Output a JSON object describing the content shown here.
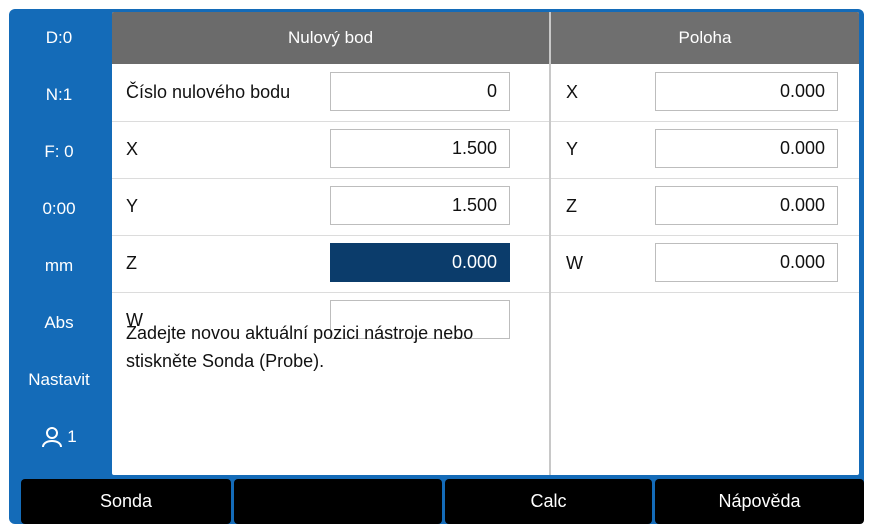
{
  "status_bar": {
    "datum": "D:0",
    "tool": "N:1",
    "feed": "F:  0",
    "time": "0:00",
    "units": "mm",
    "mode": "Abs",
    "setup": "Nastavit",
    "user": "1"
  },
  "datum_panel": {
    "title": "Nulový bod",
    "rows": [
      {
        "label": "Číslo nulového bodu",
        "value": "0",
        "active": false
      },
      {
        "label": "X",
        "value": "1.500",
        "active": false
      },
      {
        "label": "Y",
        "value": "1.500",
        "active": false
      },
      {
        "label": "Z",
        "value": "0.000",
        "active": true
      },
      {
        "label": "W",
        "value": "",
        "active": false
      }
    ],
    "message": "Zadejte novou aktuální pozici nástroje nebo stiskněte Sonda (Probe)."
  },
  "position_panel": {
    "title": "Poloha",
    "rows": [
      {
        "label": "X",
        "value": "0.000"
      },
      {
        "label": "Y",
        "value": "0.000"
      },
      {
        "label": "Z",
        "value": "0.000"
      },
      {
        "label": "W",
        "value": "0.000"
      }
    ]
  },
  "softkeys": [
    "Sonda",
    "",
    "Calc",
    "Nápověda"
  ],
  "colors": {
    "frame": "#146bb8",
    "active_field": "#0b3c6b",
    "header": "#6b6b6b",
    "softkey": "#000000"
  }
}
